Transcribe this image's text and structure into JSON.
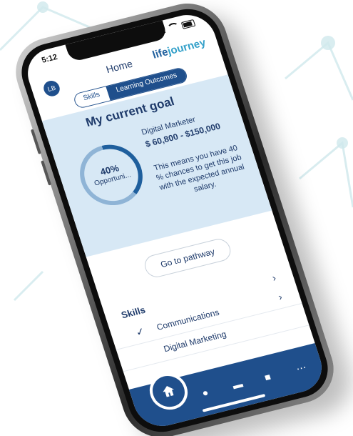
{
  "status_bar": {
    "time": "5:12"
  },
  "header": {
    "title": "Home",
    "logo": {
      "part1": "life",
      "part2": "journey"
    },
    "avatar_initials": "LB"
  },
  "tabs": [
    {
      "label": "Skills",
      "active": false
    },
    {
      "label": "Learning Outcomes",
      "active": true
    }
  ],
  "goal": {
    "heading": "My current goal",
    "percent": "40%",
    "percent_value": 0.4,
    "ring_label": "Opportuni...",
    "job_title": "Digital Marketer",
    "salary": "$ 60,800 - $150,000",
    "description": "This means you have 40 % chances to get this job with the expected annual salary."
  },
  "pathway_button": "Go to pathway",
  "skills": {
    "heading": "Skills",
    "items": [
      {
        "name": "Communications",
        "checked": true
      },
      {
        "name": "Digital Marketing",
        "checked": false
      }
    ]
  },
  "nav": {
    "items": [
      "home-icon",
      "compass-icon",
      "wallet-icon",
      "briefcase-icon",
      "more-icon"
    ]
  },
  "colors": {
    "primary": "#1f4f8c",
    "card": "#d7e8f5",
    "accent": "#33a0c9"
  }
}
